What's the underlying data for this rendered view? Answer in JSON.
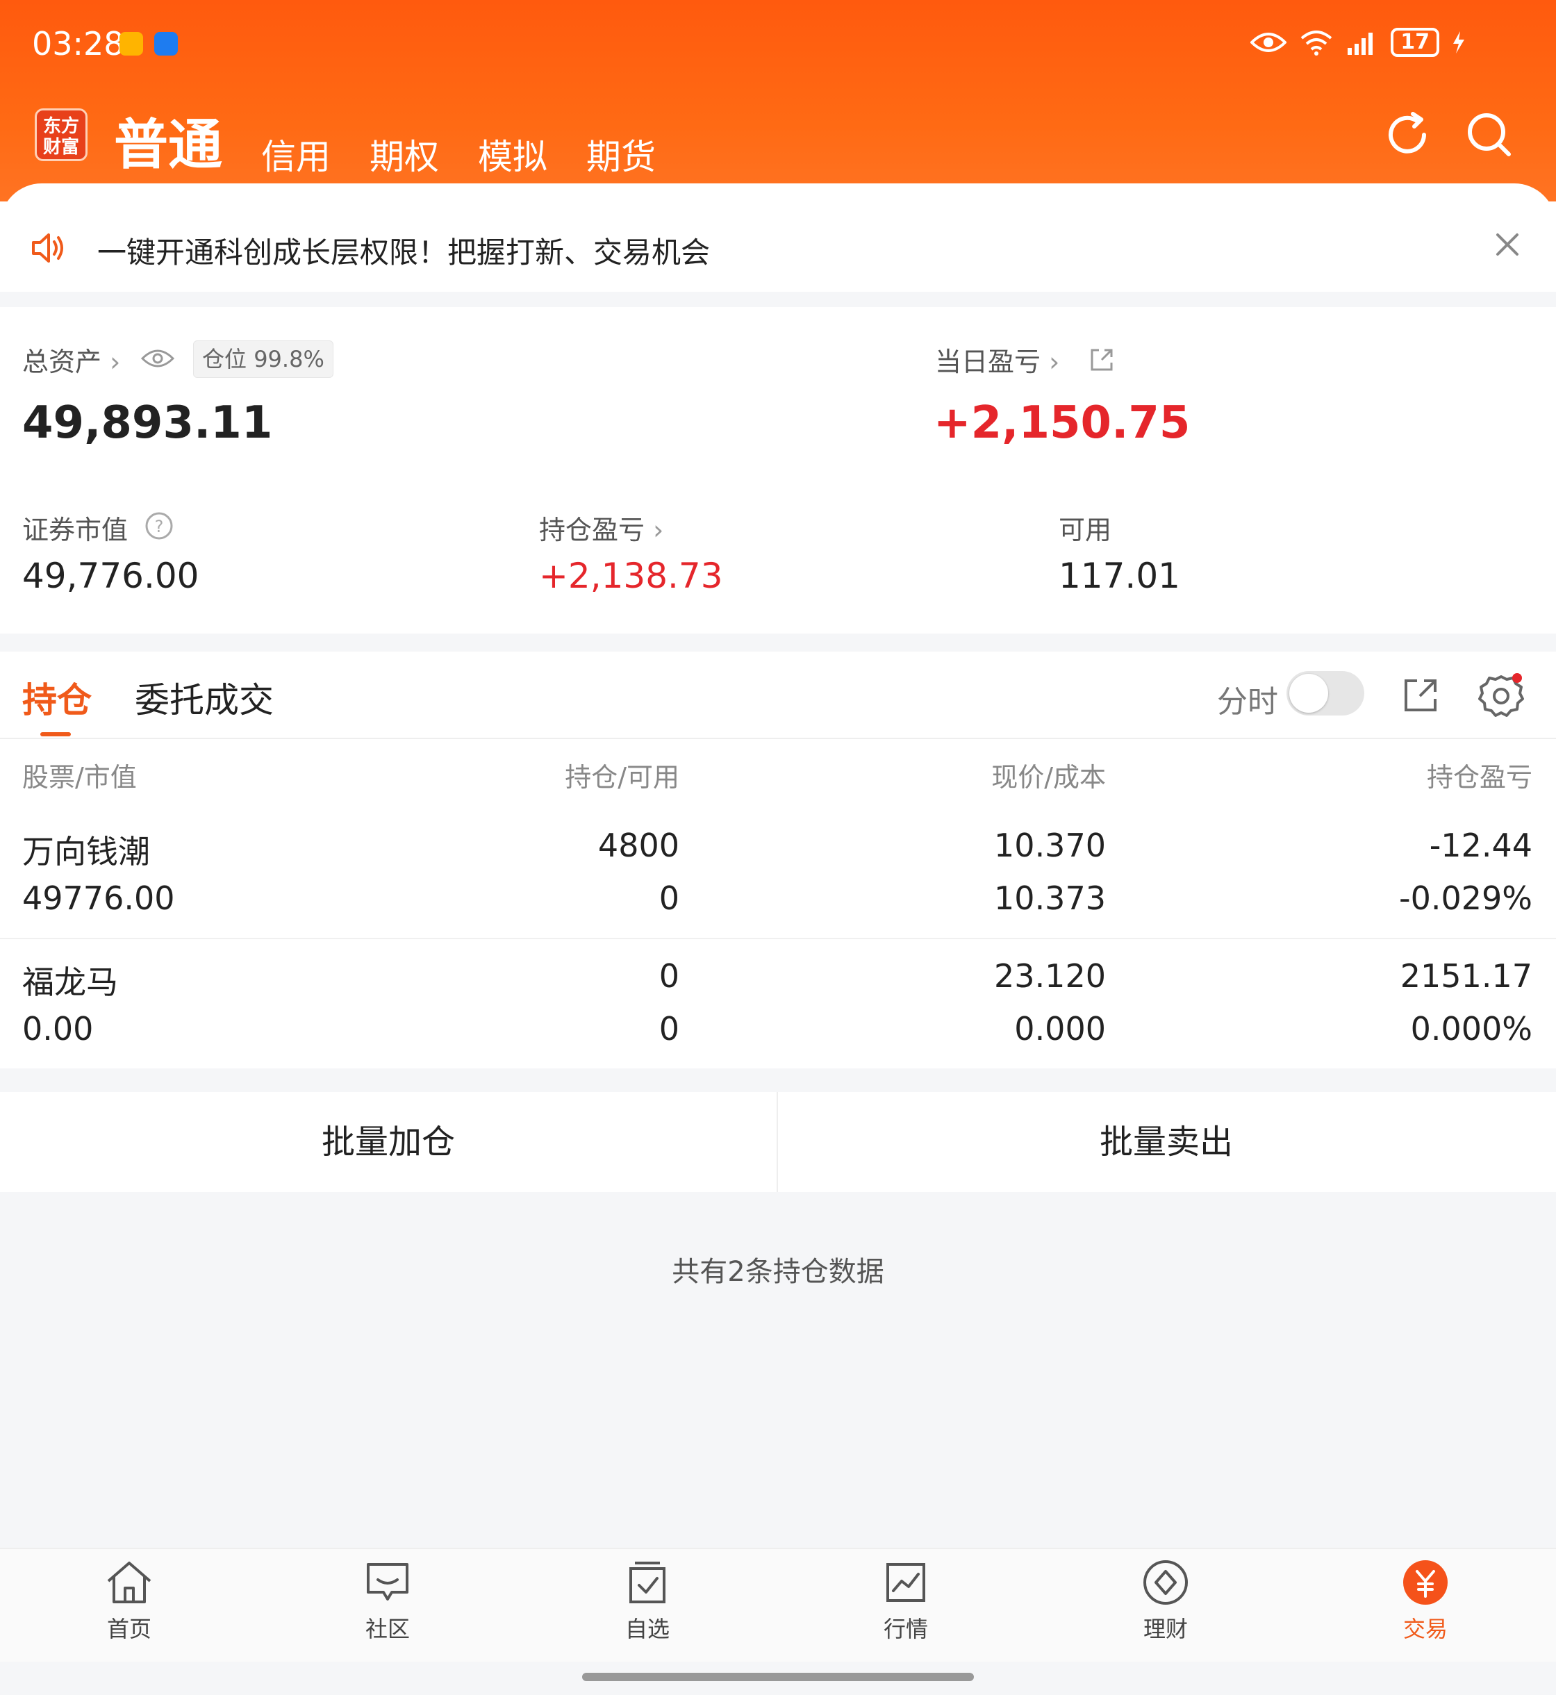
{
  "status_bar": {
    "time": "03:28",
    "battery": "17"
  },
  "header": {
    "logo_line1": "东方",
    "logo_line2": "财富",
    "tabs": [
      {
        "label": "普通",
        "active": true
      },
      {
        "label": "信用"
      },
      {
        "label": "期权"
      },
      {
        "label": "模拟"
      },
      {
        "label": "期货"
      }
    ]
  },
  "notice": {
    "text": "一键开通科创成长层权限！把握打新、交易机会"
  },
  "assets": {
    "total_label": "总资产",
    "position_label": "仓位",
    "position_value": "99.8%",
    "total_value": "49,893.11",
    "daily_pl_label": "当日盈亏",
    "daily_pl_value": "+2,150.75",
    "market_value_label": "证券市值",
    "market_value": "49,776.00",
    "holding_pl_label": "持仓盈亏",
    "holding_pl_value": "+2,138.73",
    "available_label": "可用",
    "available_value": "117.01"
  },
  "holdings": {
    "tab_holdings": "持仓",
    "tab_orders": "委托成交",
    "fenshi_label": "分时",
    "columns": [
      "股票/市值",
      "持仓/可用",
      "现价/成本",
      "持仓盈亏"
    ],
    "rows": [
      {
        "name": "万向钱潮",
        "market_value": "49776.00",
        "qty": "4800",
        "avail": "0",
        "price": "10.370",
        "cost": "10.373",
        "pl": "-12.44",
        "pl_pct": "-0.029%",
        "trend": "down"
      },
      {
        "name": "福龙马",
        "market_value": "0.00",
        "qty": "0",
        "avail": "0",
        "price": "23.120",
        "cost": "0.000",
        "pl": "2151.17",
        "pl_pct": "0.000%",
        "trend": "up"
      }
    ],
    "bulk_add": "批量加仓",
    "bulk_sell": "批量卖出",
    "count_text": "共有2条持仓数据"
  },
  "nav": [
    {
      "label": "首页",
      "icon": "home-icon"
    },
    {
      "label": "社区",
      "icon": "chat-icon"
    },
    {
      "label": "自选",
      "icon": "watchlist-icon"
    },
    {
      "label": "行情",
      "icon": "chart-icon"
    },
    {
      "label": "理财",
      "icon": "diamond-icon"
    },
    {
      "label": "交易",
      "icon": "trade-yen-icon",
      "active": true
    }
  ],
  "colors": {
    "brand": "#ff5a0e",
    "up": "#e5262b",
    "down": "#1a9a3b",
    "accent": "#f05a1a"
  }
}
